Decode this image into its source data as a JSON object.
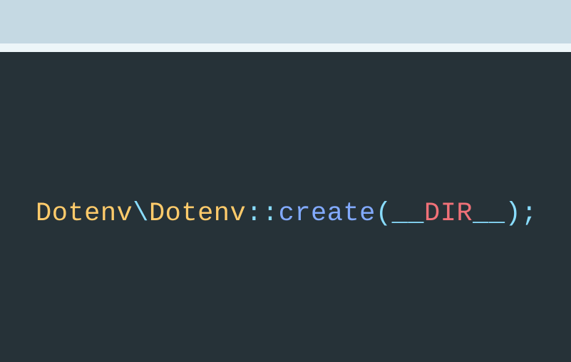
{
  "code": {
    "class1": "Dotenv",
    "backslash": "\\",
    "class2": "Dotenv",
    "dblcolon": "::",
    "method": "create",
    "paren_open": "(",
    "under_lead": "__",
    "const_core": "DIR",
    "under_trail": "__",
    "paren_close": ")",
    "semi": ";"
  }
}
